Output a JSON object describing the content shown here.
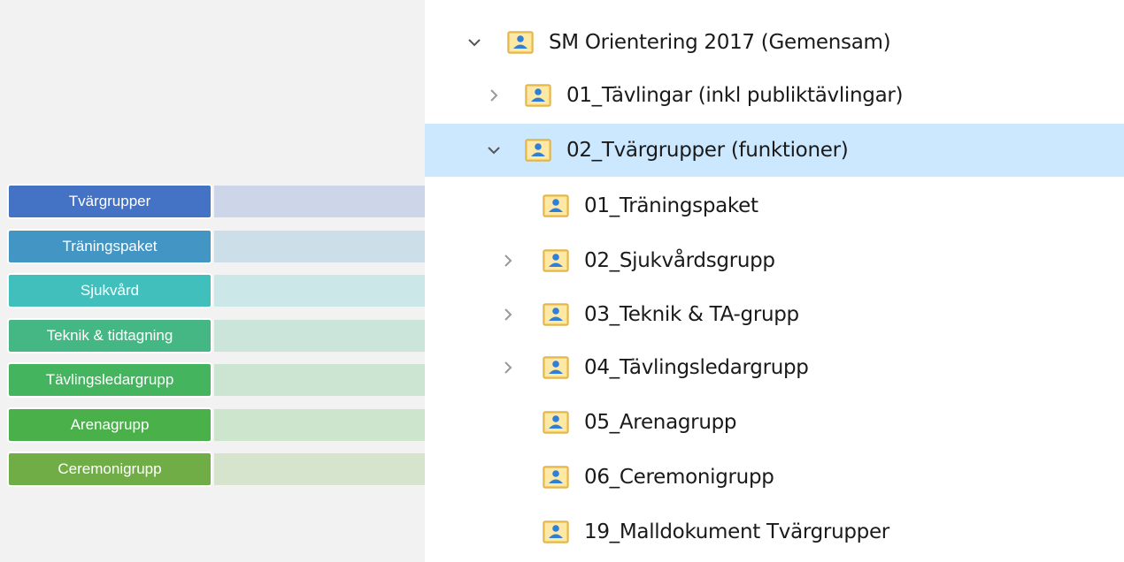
{
  "tree": {
    "root": {
      "label": "SM Orientering 2017 (Gemensam)",
      "expanded": true
    },
    "items": [
      {
        "label": "01_Tävlingar (inkl publiktävlingar)",
        "chevron": "right",
        "selected": false
      },
      {
        "label": "02_Tvärgrupper (funktioner)",
        "chevron": "down",
        "selected": true
      }
    ],
    "children": [
      {
        "label": "01_Träningspaket",
        "chevron": "none"
      },
      {
        "label": "02_Sjukvårdsgrupp",
        "chevron": "right"
      },
      {
        "label": "03_Teknik & TA-grupp",
        "chevron": "right"
      },
      {
        "label": "04_Tävlingsledargrupp",
        "chevron": "right"
      },
      {
        "label": "05_Arenagrupp",
        "chevron": "none"
      },
      {
        "label": "06_Ceremonigrupp",
        "chevron": "none"
      },
      {
        "label": "19_Malldokument Tvärgrupper",
        "chevron": "none"
      }
    ]
  },
  "labels": [
    {
      "text": "Tvärgrupper",
      "color": "#4472c4"
    },
    {
      "text": "Träningspaket",
      "color": "#4395c3"
    },
    {
      "text": "Sjukvård",
      "color": "#40bfbd"
    },
    {
      "text": "Teknik & tidtagning",
      "color": "#44b784"
    },
    {
      "text": "Tävlingsledargrupp",
      "color": "#44b45e"
    },
    {
      "text": "Arenagrupp",
      "color": "#4ab04a"
    },
    {
      "text": "Ceremonigrupp",
      "color": "#70ad47"
    }
  ],
  "colors": {
    "selection": "#cce8ff",
    "folder": "#f5cf6a",
    "person_icon": "#2f7fd8"
  }
}
